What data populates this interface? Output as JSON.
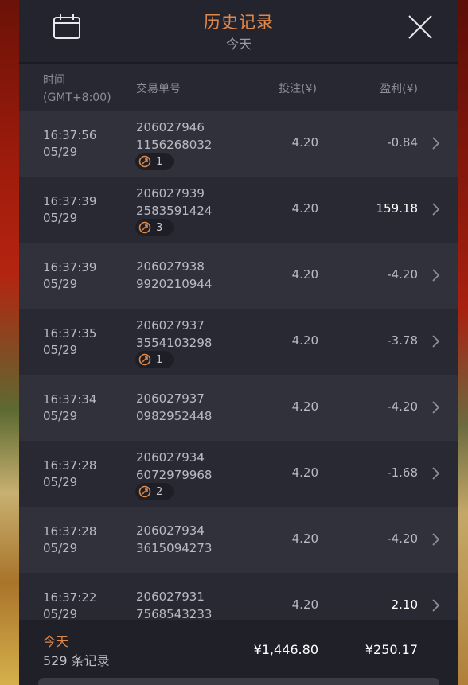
{
  "header": {
    "title": "历史记录",
    "subtitle": "今天"
  },
  "columns": {
    "time_line1": "时间",
    "time_line2": "(GMT+8:00)",
    "order": "交易单号",
    "bet": "投注(¥)",
    "profit": "盈利(¥)"
  },
  "rows": [
    {
      "time": "16:37:56",
      "date": "05/29",
      "order1": "206027946",
      "order2": "1156268032",
      "badge": "1",
      "bet": "4.20",
      "profit": "-0.84",
      "win": false
    },
    {
      "time": "16:37:39",
      "date": "05/29",
      "order1": "206027939",
      "order2": "2583591424",
      "badge": "3",
      "bet": "4.20",
      "profit": "159.18",
      "win": true
    },
    {
      "time": "16:37:39",
      "date": "05/29",
      "order1": "206027938",
      "order2": "9920210944",
      "badge": "",
      "bet": "4.20",
      "profit": "-4.20",
      "win": false
    },
    {
      "time": "16:37:35",
      "date": "05/29",
      "order1": "206027937",
      "order2": "3554103298",
      "badge": "1",
      "bet": "4.20",
      "profit": "-3.78",
      "win": false
    },
    {
      "time": "16:37:34",
      "date": "05/29",
      "order1": "206027937",
      "order2": "0982952448",
      "badge": "",
      "bet": "4.20",
      "profit": "-4.20",
      "win": false
    },
    {
      "time": "16:37:28",
      "date": "05/29",
      "order1": "206027934",
      "order2": "6072979968",
      "badge": "2",
      "bet": "4.20",
      "profit": "-1.68",
      "win": false
    },
    {
      "time": "16:37:28",
      "date": "05/29",
      "order1": "206027934",
      "order2": "3615094273",
      "badge": "",
      "bet": "4.20",
      "profit": "-4.20",
      "win": false
    },
    {
      "time": "16:37:22",
      "date": "05/29",
      "order1": "206027931",
      "order2": "7568543233",
      "badge": "",
      "bet": "4.20",
      "profit": "2.10",
      "win": true
    }
  ],
  "footer": {
    "label": "今天",
    "count": "529 条记录",
    "total_bet": "¥1,446.80",
    "total_profit": "¥250.17"
  },
  "colors": {
    "accent": "#e0884a",
    "panel": "#272832",
    "row_odd": "#30313b",
    "row_even": "#282932"
  },
  "icons": {
    "calendar": "calendar-icon",
    "close": "close-icon",
    "chevron": "chevron-right-icon",
    "badge": "free-spin-icon"
  }
}
